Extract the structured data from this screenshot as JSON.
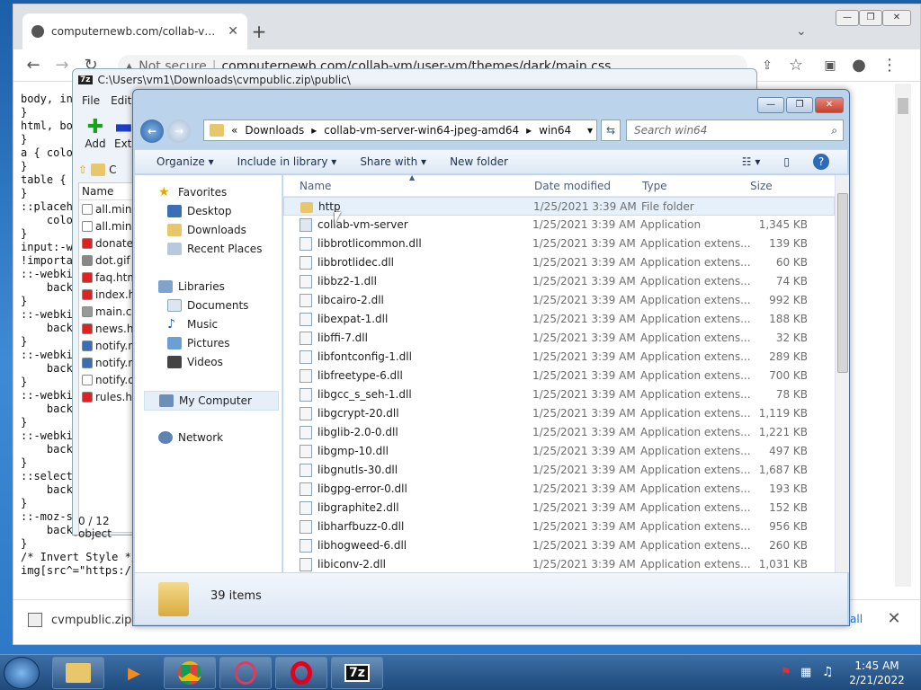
{
  "chrome": {
    "tab_title": "computernewb.com/collab-vm/u",
    "address": {
      "prefix": "Not secure",
      "url": "computernewb.com/collab-vm/user-vm/themes/dark/main.css"
    },
    "code_lines": [
      "body, in",
      "}",
      "html, bo",
      "}",
      "a { colo",
      "}",
      "table {",
      "}",
      "::placeh",
      "    colo",
      "}",
      "input:-w",
      "!importa",
      "::-webki",
      "    back",
      "}",
      "::-webki",
      "    back",
      "}",
      "::-webki",
      "    back",
      "}",
      "::-webki",
      "    back",
      "}",
      "::-webki",
      "    back",
      "}",
      "::select",
      "    back",
      "}",
      "::-moz-s",
      "    background-col",
      "}",
      "/* Invert Style */",
      "img[src^=\"https:/"
    ],
    "download": {
      "filename": "cvmpublic.zip",
      "show_all": "all"
    }
  },
  "sevenzip": {
    "title": "C:\\Users\\vm1\\Downloads\\cvmpublic.zip\\public\\",
    "menu": [
      "File",
      "Edit"
    ],
    "add_label": "Add",
    "extract_label": "Extr",
    "path_text": "C",
    "col_name": "Name",
    "files": [
      "all.min.",
      "all.min.",
      "donate.",
      "dot.gif",
      "faq.htm",
      "index.ht",
      "main.cs",
      "news.ht",
      "notify.n",
      "notify.n",
      "notify.o",
      "rules.ht"
    ],
    "status": "0 / 12 object"
  },
  "explorer": {
    "breadcrumb": [
      "Downloads",
      "collab-vm-server-win64-jpeg-amd64",
      "win64"
    ],
    "search_placeholder": "Search win64",
    "commands": [
      "Organize",
      "Include in library",
      "Share with",
      "New folder"
    ],
    "nav": {
      "favorites": "Favorites",
      "favorites_items": [
        "Desktop",
        "Downloads",
        "Recent Places"
      ],
      "libraries": "Libraries",
      "libraries_items": [
        "Documents",
        "Music",
        "Pictures",
        "Videos"
      ],
      "computer": "My Computer",
      "network": "Network"
    },
    "columns": {
      "name": "Name",
      "date": "Date modified",
      "type": "Type",
      "size": "Size"
    },
    "files": [
      {
        "name": "http",
        "date": "1/25/2021 3:39 AM",
        "type": "File folder",
        "size": ""
      },
      {
        "name": "collab-vm-server",
        "date": "1/25/2021 3:39 AM",
        "type": "Application",
        "size": "1,345 KB"
      },
      {
        "name": "libbrotlicommon.dll",
        "date": "1/25/2021 3:39 AM",
        "type": "Application extens...",
        "size": "139 KB"
      },
      {
        "name": "libbrotlidec.dll",
        "date": "1/25/2021 3:39 AM",
        "type": "Application extens...",
        "size": "60 KB"
      },
      {
        "name": "libbz2-1.dll",
        "date": "1/25/2021 3:39 AM",
        "type": "Application extens...",
        "size": "74 KB"
      },
      {
        "name": "libcairo-2.dll",
        "date": "1/25/2021 3:39 AM",
        "type": "Application extens...",
        "size": "992 KB"
      },
      {
        "name": "libexpat-1.dll",
        "date": "1/25/2021 3:39 AM",
        "type": "Application extens...",
        "size": "188 KB"
      },
      {
        "name": "libffi-7.dll",
        "date": "1/25/2021 3:39 AM",
        "type": "Application extens...",
        "size": "32 KB"
      },
      {
        "name": "libfontconfig-1.dll",
        "date": "1/25/2021 3:39 AM",
        "type": "Application extens...",
        "size": "289 KB"
      },
      {
        "name": "libfreetype-6.dll",
        "date": "1/25/2021 3:39 AM",
        "type": "Application extens...",
        "size": "700 KB"
      },
      {
        "name": "libgcc_s_seh-1.dll",
        "date": "1/25/2021 3:39 AM",
        "type": "Application extens...",
        "size": "78 KB"
      },
      {
        "name": "libgcrypt-20.dll",
        "date": "1/25/2021 3:39 AM",
        "type": "Application extens...",
        "size": "1,119 KB"
      },
      {
        "name": "libglib-2.0-0.dll",
        "date": "1/25/2021 3:39 AM",
        "type": "Application extens...",
        "size": "1,221 KB"
      },
      {
        "name": "libgmp-10.dll",
        "date": "1/25/2021 3:39 AM",
        "type": "Application extens...",
        "size": "497 KB"
      },
      {
        "name": "libgnutls-30.dll",
        "date": "1/25/2021 3:39 AM",
        "type": "Application extens...",
        "size": "1,687 KB"
      },
      {
        "name": "libgpg-error-0.dll",
        "date": "1/25/2021 3:39 AM",
        "type": "Application extens...",
        "size": "193 KB"
      },
      {
        "name": "libgraphite2.dll",
        "date": "1/25/2021 3:39 AM",
        "type": "Application extens...",
        "size": "152 KB"
      },
      {
        "name": "libharfbuzz-0.dll",
        "date": "1/25/2021 3:39 AM",
        "type": "Application extens...",
        "size": "956 KB"
      },
      {
        "name": "libhogweed-6.dll",
        "date": "1/25/2021 3:39 AM",
        "type": "Application extens...",
        "size": "260 KB"
      },
      {
        "name": "libiconv-2.dll",
        "date": "1/25/2021 3:39 AM",
        "type": "Application extens...",
        "size": "1,031 KB"
      }
    ],
    "item_count": "39 items"
  },
  "taskbar": {
    "apps": [
      "explorer-icon",
      "media-player-icon",
      "chrome-icon",
      "opera-gx-icon",
      "opera-icon",
      "7zip-icon"
    ],
    "sevenzip_label": "7z",
    "time": "1:45 AM",
    "date": "2/21/2022"
  }
}
